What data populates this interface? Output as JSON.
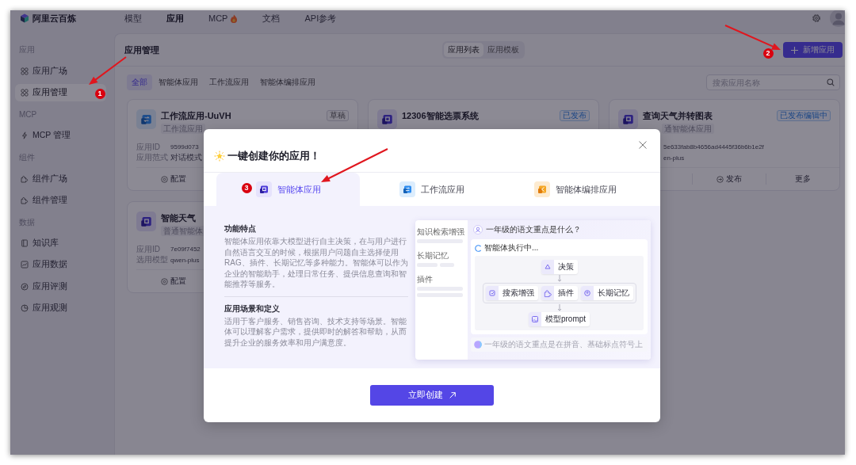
{
  "topbar": {
    "brand": "阿里云百炼",
    "nav": [
      {
        "label": "模型",
        "selected": false,
        "hot": false
      },
      {
        "label": "应用",
        "selected": true,
        "hot": false
      },
      {
        "label": "MCP",
        "selected": false,
        "hot": true
      },
      {
        "label": "文档",
        "selected": false,
        "hot": false
      },
      {
        "label": "API参考",
        "selected": false,
        "hot": false
      }
    ]
  },
  "sidebar": [
    {
      "title": "应用",
      "items": [
        {
          "label": "应用广场",
          "selected": false
        },
        {
          "label": "应用管理",
          "selected": true
        }
      ]
    },
    {
      "title": "MCP",
      "items": [
        {
          "label": "MCP 管理",
          "selected": false
        }
      ]
    },
    {
      "title": "组件",
      "items": [
        {
          "label": "组件广场",
          "selected": false
        },
        {
          "label": "组件管理",
          "selected": false
        }
      ]
    },
    {
      "title": "数据",
      "items": [
        {
          "label": "知识库",
          "selected": false
        },
        {
          "label": "应用数据",
          "selected": false
        },
        {
          "label": "应用评测",
          "selected": false
        },
        {
          "label": "应用观测",
          "selected": false
        }
      ]
    }
  ],
  "panel": {
    "title": "应用管理",
    "views": [
      {
        "label": "应用列表",
        "selected": true
      },
      {
        "label": "应用模板",
        "selected": false
      }
    ],
    "new_button": "新增应用",
    "filters": [
      {
        "label": "全部",
        "selected": true
      },
      {
        "label": "智能体应用",
        "selected": false
      },
      {
        "label": "工作流应用",
        "selected": false
      },
      {
        "label": "智能体编排应用",
        "selected": false
      }
    ],
    "search": {
      "placeholder": "搜索应用名称"
    },
    "cards": [
      {
        "kind": "workflow",
        "title": "工作流应用-UuVH",
        "status": {
          "label": "草稿",
          "kind": "draft"
        },
        "type": "工作流应用",
        "fields": [
          {
            "label": "应用ID",
            "value": "9599d073",
            "kind": "code"
          },
          {
            "label": "应用范式",
            "value": "对话模式",
            "kind": "text"
          }
        ],
        "actions": [
          {
            "label": "配置",
            "kind": "config"
          }
        ]
      },
      {
        "kind": "agent",
        "title": "12306智能选票系统",
        "status": {
          "label": "已发布",
          "kind": "published"
        }
      },
      {
        "kind": "agent",
        "covered_left": true,
        "title": "查询天气并转图表",
        "status": {
          "label": "已发布编辑中",
          "kind": "published"
        },
        "type": "通智能体应用",
        "fields": [
          {
            "value": "5e633fab8b4656ad4445f36b6b1e2f",
            "kind": "code"
          },
          {
            "value": "en-plus",
            "kind": "code"
          }
        ],
        "actions": [
          {
            "label": "发布",
            "kind": "publish"
          },
          {
            "label": "更多",
            "kind": "more"
          }
        ]
      },
      {
        "kind": "agent",
        "title": "智能天气",
        "type": "普通智能体",
        "fields": [
          {
            "label": "应用ID",
            "value": "7e09f7452",
            "kind": "code"
          },
          {
            "label": "选用模型",
            "value": "qwen-plus",
            "kind": "code"
          }
        ],
        "actions": [
          {
            "label": "配置",
            "kind": "config"
          }
        ]
      }
    ]
  },
  "dialog": {
    "title": "一键创建你的应用！",
    "tabs": [
      {
        "label": "智能体应用",
        "selected": true,
        "kind": "agent"
      },
      {
        "label": "工作流应用",
        "selected": false,
        "kind": "workflow"
      },
      {
        "label": "智能体编排应用",
        "selected": false,
        "kind": "orchestration"
      }
    ],
    "sections": [
      {
        "heading": "功能特点",
        "text": "智能体应用依靠大模型进行自主决策，在与用户进行自然语言交互的时候，根据用户问题自主选择使用RAG、插件、长期记忆等多种能力。智能体可以作为企业的智能助手，处理日常任务、提供信息查询和智能推荐等服务。"
      },
      {
        "heading": "应用场景和定义",
        "text": "适用于客户服务、销售咨询、技术支持等场景。智能体可以理解客户需求，提供即时的解答和帮助，从而提升企业的服务效率和用户满意度。"
      }
    ],
    "preview": {
      "sidebar": [
        "知识检索增强",
        "长期记忆",
        "插件"
      ],
      "question": "一年级的语文重点是什么？",
      "status": "智能体执行中...",
      "decision": "决策",
      "tools": [
        "搜索增强",
        "插件",
        "长期记忆"
      ],
      "model": "模型prompt",
      "answer": "一年级的语文重点是在拼音、基础标点符号上"
    },
    "create_button": "立即创建"
  },
  "annotations": [
    {
      "number": "1"
    },
    {
      "number": "2"
    },
    {
      "number": "3"
    }
  ]
}
